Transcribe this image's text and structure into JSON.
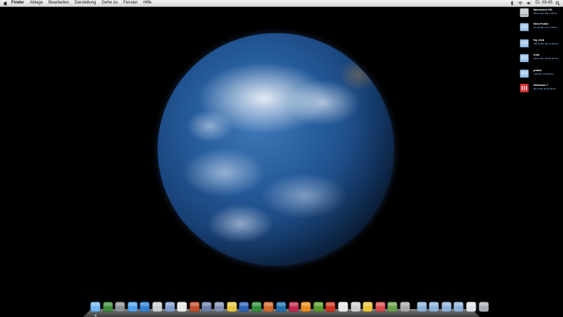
{
  "menubar": {
    "apple_icon": "apple-logo",
    "items": [
      "Finder",
      "Ablage",
      "Bearbeiten",
      "Darstellung",
      "Gehe zu",
      "Fenster",
      "Hilfe"
    ],
    "status_icons": [
      "bluetooth-icon",
      "wifi-icon",
      "volume-icon"
    ],
    "clock": "Di. 09:45",
    "spotlight_icon": "spotlight-search-icon"
  },
  "desktop": {
    "wallpaper": "earth",
    "volumes": [
      {
        "name": "Macintosh HD",
        "info": "999,31 GB, 834,7 GB frei",
        "icon": "hard-drive-icon"
      },
      {
        "name": "New-Public",
        "info": "161,06 GB, 107,1 GB frei",
        "icon": "network-volume-icon"
      },
      {
        "name": "fig_med",
        "info": "498,76 GB, 494,74 GB frei",
        "icon": "network-volume-icon"
      },
      {
        "name": "hold",
        "info": "299,11 GB, 263,81 GB frei",
        "icon": "network-volume-icon"
      },
      {
        "name": "public",
        "info": "4,96 GB, 2,15 GB frei",
        "icon": "network-volume-icon"
      },
      {
        "name": "Windows 7",
        "info": "99,73 GB, 26,19 GB frei",
        "icon": "bootcamp-volume-icon"
      }
    ]
  },
  "dock": {
    "apps": [
      {
        "name": "Finder",
        "icon": "finder-icon",
        "color": "#6fb6f2",
        "running": true
      },
      {
        "name": "Photo Booth",
        "icon": "photo-booth-icon",
        "color": "#3a8a3a",
        "running": false
      },
      {
        "name": "System Preferences",
        "icon": "system-preferences-icon",
        "color": "#8a8f96",
        "running": false
      },
      {
        "name": "iTunes",
        "icon": "itunes-icon",
        "color": "#4da0e8",
        "running": false
      },
      {
        "name": "Safari",
        "icon": "safari-icon",
        "color": "#2f7fd0",
        "running": false
      },
      {
        "name": "Mail",
        "icon": "mail-icon",
        "color": "#c9ccd2",
        "running": false
      },
      {
        "name": "Address Book",
        "icon": "address-book-icon",
        "color": "#7e9bc9",
        "running": false
      },
      {
        "name": "iCal",
        "icon": "ical-icon",
        "color": "#e8e8e8",
        "running": false
      },
      {
        "name": "Stickies",
        "icon": "stickies-icon",
        "color": "#c04d2a",
        "running": false
      },
      {
        "name": "Photo Editor",
        "icon": "photo-editor-icon",
        "color": "#6a7fa8",
        "running": false
      },
      {
        "name": "Script Editor",
        "icon": "script-editor-icon",
        "color": "#7c8fb0",
        "running": false
      },
      {
        "name": "Network Tool",
        "icon": "network-tool-icon",
        "color": "#e3c640",
        "running": false
      },
      {
        "name": "Word",
        "icon": "word-icon",
        "color": "#2a5fb5",
        "running": false
      },
      {
        "name": "Excel",
        "icon": "excel-icon",
        "color": "#2f8f3a",
        "running": false
      },
      {
        "name": "PowerPoint",
        "icon": "powerpoint-icon",
        "color": "#d2692a",
        "running": false
      },
      {
        "name": "Photoshop",
        "icon": "photoshop-icon",
        "color": "#1f6fae",
        "running": false
      },
      {
        "name": "InDesign",
        "icon": "indesign-icon",
        "color": "#c1274e",
        "running": false
      },
      {
        "name": "Illustrator",
        "icon": "illustrator-icon",
        "color": "#ea8b1d",
        "running": false
      },
      {
        "name": "Dreamweaver",
        "icon": "dreamweaver-icon",
        "color": "#5a9a2a",
        "running": false
      },
      {
        "name": "Flash",
        "icon": "flash-icon",
        "color": "#c8321f",
        "running": false
      },
      {
        "name": "Acrobat",
        "icon": "acrobat-icon",
        "color": "#e8e8e8",
        "running": false
      },
      {
        "name": "Acrobat Distiller",
        "icon": "distiller-icon",
        "color": "#d0d0d0",
        "running": false
      },
      {
        "name": "Bridge",
        "icon": "bridge-icon",
        "color": "#e8c23a",
        "running": false
      },
      {
        "name": "Colors",
        "icon": "color-picker-icon",
        "color": "#d84b4b",
        "running": false
      },
      {
        "name": "Games",
        "icon": "games-icon",
        "color": "#6aa04a",
        "running": false
      },
      {
        "name": "Boot Camp",
        "icon": "bootcamp-icon",
        "color": "#a8a8a8",
        "running": false
      }
    ],
    "stacks": [
      {
        "name": "Applications",
        "icon": "applications-folder-icon",
        "color": "#8bb0d8"
      },
      {
        "name": "Documents",
        "icon": "documents-folder-icon",
        "color": "#8bb0d8"
      },
      {
        "name": "Downloads",
        "icon": "downloads-folder-icon",
        "color": "#8bb0d8"
      },
      {
        "name": "Server",
        "icon": "server-volume-icon",
        "color": "#8bb0d8"
      },
      {
        "name": "Preview",
        "icon": "preview-window-icon",
        "color": "#dfe3ea"
      },
      {
        "name": "Trash",
        "icon": "trash-icon",
        "color": "#a9aeb4"
      }
    ]
  }
}
